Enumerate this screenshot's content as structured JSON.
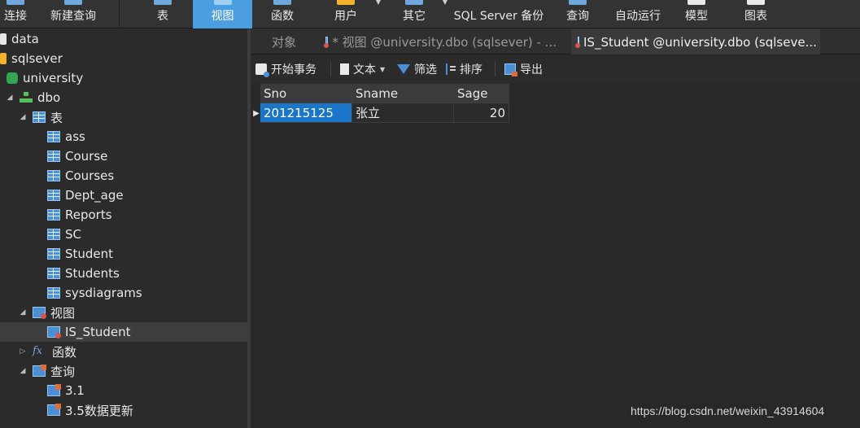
{
  "toolbar": {
    "items": [
      {
        "label": "连接"
      },
      {
        "label": "新建查询"
      },
      {
        "label": "表"
      },
      {
        "label": "视图"
      },
      {
        "label": "函数"
      },
      {
        "label": "用户"
      },
      {
        "label": "其它"
      },
      {
        "label": "SQL Server 备份"
      },
      {
        "label": "查询"
      },
      {
        "label": "自动运行"
      },
      {
        "label": "模型"
      },
      {
        "label": "图表"
      }
    ],
    "active": "视图"
  },
  "sidebar": {
    "items": [
      {
        "label": "data"
      },
      {
        "label": "sqlsever"
      },
      {
        "label": "university"
      },
      {
        "label": "dbo"
      },
      {
        "label": "表"
      },
      {
        "label": "ass"
      },
      {
        "label": "Course"
      },
      {
        "label": "Courses"
      },
      {
        "label": "Dept_age"
      },
      {
        "label": "Reports"
      },
      {
        "label": "SC"
      },
      {
        "label": "Student"
      },
      {
        "label": "Students"
      },
      {
        "label": "sysdiagrams"
      },
      {
        "label": "视图"
      },
      {
        "label": "IS_Student"
      },
      {
        "label": "函数"
      },
      {
        "label": "查询"
      },
      {
        "label": "3.1"
      },
      {
        "label": "3.5数据更新"
      }
    ],
    "selected": "IS_Student"
  },
  "tabs": [
    {
      "label": "对象"
    },
    {
      "label": "* 视图 @university.dbo (sqlsever) - ..."
    },
    {
      "label": "IS_Student @university.dbo (sqlseve..."
    }
  ],
  "grid_toolbar": {
    "begin_transaction": "开始事务",
    "text": "文本",
    "filter": "筛选",
    "sort": "排序",
    "export": "导出"
  },
  "grid": {
    "columns": [
      "Sno",
      "Sname",
      "Sage"
    ],
    "rows": [
      [
        "201215125",
        "张立",
        "20"
      ]
    ]
  },
  "watermark": "https://blog.csdn.net/weixin_43914604",
  "colors": {
    "accent": "#4b9ee0",
    "selection": "#1b76c9"
  }
}
